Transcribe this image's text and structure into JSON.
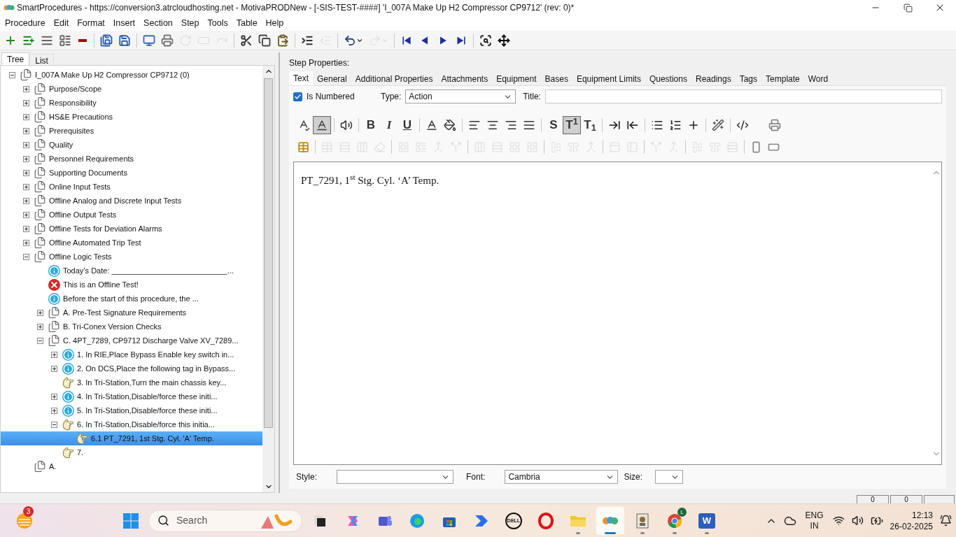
{
  "window": {
    "title": "SmartProcedures - https://conversion3.atrcloudhosting.net - MotivaPRODNew - [-SIS-TEST-####] 'I_007A Make Up H2 Compressor CP9712' (rev: 0)*"
  },
  "menu": [
    "Procedure",
    "Edit",
    "Format",
    "Insert",
    "Section",
    "Step",
    "Tools",
    "Table",
    "Help"
  ],
  "toolbar": [
    {
      "kind": "add",
      "disabled": false
    },
    {
      "kind": "add-child",
      "disabled": false
    },
    {
      "kind": "list",
      "disabled": false
    },
    {
      "kind": "properties",
      "disabled": false
    },
    {
      "kind": "remove",
      "disabled": false
    },
    {
      "kind": "separator"
    },
    {
      "kind": "save-all",
      "disabled": false
    },
    {
      "kind": "save",
      "disabled": false
    },
    {
      "kind": "separator"
    },
    {
      "kind": "computer",
      "disabled": false
    },
    {
      "kind": "print",
      "disabled": false
    },
    {
      "kind": "refresh",
      "disabled": true
    },
    {
      "kind": "form",
      "disabled": true
    },
    {
      "kind": "forward",
      "disabled": true
    },
    {
      "kind": "separator"
    },
    {
      "kind": "cut",
      "disabled": false
    },
    {
      "kind": "copy",
      "disabled": false
    },
    {
      "kind": "paste",
      "disabled": false
    },
    {
      "kind": "separator"
    },
    {
      "kind": "indent",
      "disabled": false
    },
    {
      "kind": "outdent",
      "disabled": true
    },
    {
      "kind": "separator"
    },
    {
      "kind": "undo",
      "disabled": false
    },
    {
      "kind": "redo",
      "disabled": true
    },
    {
      "kind": "separator"
    },
    {
      "kind": "first",
      "disabled": false
    },
    {
      "kind": "prev",
      "disabled": false
    },
    {
      "kind": "next",
      "disabled": false
    },
    {
      "kind": "last",
      "disabled": false
    },
    {
      "kind": "separator"
    },
    {
      "kind": "find",
      "disabled": false
    },
    {
      "kind": "move",
      "disabled": false
    }
  ],
  "left_tabs": [
    {
      "label": "Tree",
      "selected": true
    },
    {
      "label": "List",
      "selected": false
    }
  ],
  "tree": [
    {
      "label": "I_007A Make Up H2 Compressor CP9712 (0)",
      "kind": "section",
      "expandable": true,
      "expanded": true,
      "selected": false,
      "children": [
        {
          "label": "Purpose/Scope",
          "kind": "section",
          "expandable": true,
          "expanded": false,
          "selected": false
        },
        {
          "label": "Responsibility",
          "kind": "section",
          "expandable": true,
          "expanded": false,
          "selected": false
        },
        {
          "label": "HS&E Precautions",
          "kind": "section",
          "expandable": true,
          "expanded": false,
          "selected": false
        },
        {
          "label": "Prerequisites",
          "kind": "section",
          "expandable": true,
          "expanded": false,
          "selected": false
        },
        {
          "label": "Quality",
          "kind": "section",
          "expandable": true,
          "expanded": false,
          "selected": false
        },
        {
          "label": "Personnel Requirements",
          "kind": "section",
          "expandable": true,
          "expanded": false,
          "selected": false
        },
        {
          "label": "Supporting Documents",
          "kind": "section",
          "expandable": true,
          "expanded": false,
          "selected": false
        },
        {
          "label": "Online Input Tests",
          "kind": "section",
          "expandable": true,
          "expanded": false,
          "selected": false
        },
        {
          "label": "Offline Analog and Discrete Input Tests",
          "kind": "section",
          "expandable": true,
          "expanded": false,
          "selected": false
        },
        {
          "label": "Offline Output Tests",
          "kind": "section",
          "expandable": true,
          "expanded": false,
          "selected": false
        },
        {
          "label": "Offline Tests for Deviation Alarms",
          "kind": "section",
          "expandable": true,
          "expanded": false,
          "selected": false
        },
        {
          "label": "Offline Automated Trip Test",
          "kind": "section",
          "expandable": true,
          "expanded": false,
          "selected": false
        },
        {
          "label": "Offline Logic Tests",
          "kind": "section",
          "expandable": true,
          "expanded": true,
          "selected": false,
          "children": [
            {
              "label": "Today’s Date: ___________________________...",
              "kind": "info",
              "expandable": false,
              "expanded": false,
              "selected": false
            },
            {
              "label": "This is an Offline Test!",
              "kind": "error",
              "expandable": false,
              "expanded": false,
              "selected": false
            },
            {
              "label": "Before the start of this procedure, the ...",
              "kind": "info",
              "expandable": false,
              "expanded": false,
              "selected": false
            },
            {
              "label": "A. Pre-Test Signature Requirements",
              "kind": "section",
              "expandable": true,
              "expanded": false,
              "selected": false
            },
            {
              "label": "B. Tri-Conex Version Checks",
              "kind": "section",
              "expandable": true,
              "expanded": false,
              "selected": false
            },
            {
              "label": "C. 4PT_7289, CP9712 Discharge Valve XV_7289...",
              "kind": "section",
              "expandable": true,
              "expanded": true,
              "selected": false,
              "children": [
                {
                  "label": "1. In RIE,Place Bypass Enable key switch in...",
                  "kind": "info",
                  "expandable": true,
                  "expanded": false,
                  "selected": false
                },
                {
                  "label": "2. On DCS,Place the following tag in Bypass...",
                  "kind": "info",
                  "expandable": true,
                  "expanded": false,
                  "selected": false
                },
                {
                  "label": "3. In Tri-Station,Turn the main chassis key...",
                  "kind": "action",
                  "expandable": false,
                  "expanded": false,
                  "selected": false
                },
                {
                  "label": "4. In Tri-Station,Disable/force these initi...",
                  "kind": "info",
                  "expandable": true,
                  "expanded": false,
                  "selected": false
                },
                {
                  "label": "5. In Tri-Station,Disable/force these initi...",
                  "kind": "info",
                  "expandable": true,
                  "expanded": false,
                  "selected": false
                },
                {
                  "label": "6. In Tri-Station,Disable/force this initia...",
                  "kind": "action",
                  "expandable": true,
                  "expanded": true,
                  "selected": false,
                  "children": [
                    {
                      "label": "6.1 PT_7291, 1st Stg. Cyl. 'A' Temp.",
                      "kind": "action",
                      "expandable": false,
                      "expanded": false,
                      "selected": true
                    }
                  ]
                },
                {
                  "label": "7.",
                  "kind": "action",
                  "expandable": false,
                  "expanded": false,
                  "selected": false
                }
              ]
            }
          ]
        },
        {
          "label": "A.",
          "kind": "section",
          "expandable": false,
          "expanded": false,
          "selected": false
        }
      ]
    }
  ],
  "step_properties": {
    "heading": "Step Properties:",
    "tabs": [
      {
        "label": "Text",
        "selected": true
      },
      {
        "label": "General",
        "selected": false
      },
      {
        "label": "Additional Properties",
        "selected": false
      },
      {
        "label": "Attachments",
        "selected": false
      },
      {
        "label": "Equipment",
        "selected": false
      },
      {
        "label": "Bases",
        "selected": false
      },
      {
        "label": "Equipment Limits",
        "selected": false
      },
      {
        "label": "Questions",
        "selected": false
      },
      {
        "label": "Readings",
        "selected": false
      },
      {
        "label": "Tags",
        "selected": false
      },
      {
        "label": "Template",
        "selected": false
      },
      {
        "label": "Word",
        "selected": false
      }
    ],
    "is_numbered": {
      "label": "Is Numbered",
      "checked": true
    },
    "type": {
      "label": "Type:",
      "value": "Action"
    },
    "title": {
      "label": "Title:"
    },
    "format_row_1": [
      {
        "kind": "spell",
        "pressed": false
      },
      {
        "kind": "spell-auto",
        "pressed": true
      },
      {
        "kind": "separator"
      },
      {
        "kind": "speaker",
        "pressed": false
      },
      {
        "kind": "separator"
      },
      {
        "kind": "bold",
        "label": "B",
        "pressed": false
      },
      {
        "kind": "italic",
        "label": "I",
        "pressed": false
      },
      {
        "kind": "underline",
        "label": "U",
        "pressed": false
      },
      {
        "kind": "separator"
      },
      {
        "kind": "font-color",
        "pressed": false
      },
      {
        "kind": "fill",
        "pressed": false
      },
      {
        "kind": "separator"
      },
      {
        "kind": "align-left",
        "pressed": false
      },
      {
        "kind": "align-center",
        "pressed": false
      },
      {
        "kind": "align-right",
        "pressed": false
      },
      {
        "kind": "justify",
        "pressed": false
      },
      {
        "kind": "separator"
      },
      {
        "kind": "strike",
        "label": "S",
        "pressed": false
      },
      {
        "kind": "superscript",
        "label": "T$^{1}$",
        "pressed": true
      },
      {
        "kind": "subscript",
        "label": "T$_{1}$",
        "pressed": false
      },
      {
        "kind": "separator"
      },
      {
        "kind": "indent-right",
        "pressed": false
      },
      {
        "kind": "indent-left",
        "pressed": false
      },
      {
        "kind": "separator"
      },
      {
        "kind": "bullets",
        "pressed": false
      },
      {
        "kind": "numbers",
        "pressed": false
      },
      {
        "kind": "plus-line",
        "pressed": false
      },
      {
        "kind": "separator"
      },
      {
        "kind": "wand",
        "pressed": false
      },
      {
        "kind": "separator"
      },
      {
        "kind": "code",
        "pressed": false
      },
      {
        "kind": "gap"
      },
      {
        "kind": "print",
        "pressed": false
      }
    ],
    "format_row_2": [
      {
        "kind": "table-insert",
        "disabled": false
      },
      {
        "kind": "separator"
      },
      {
        "kind": "table-delete",
        "disabled": true
      },
      {
        "kind": "rows",
        "disabled": true
      },
      {
        "kind": "cols",
        "disabled": true
      },
      {
        "kind": "erase",
        "disabled": true
      },
      {
        "kind": "separator"
      },
      {
        "kind": "grid",
        "disabled": true
      },
      {
        "kind": "properties",
        "disabled": true
      },
      {
        "kind": "merge",
        "disabled": true
      },
      {
        "kind": "split",
        "disabled": true
      },
      {
        "kind": "separator"
      },
      {
        "kind": "cols",
        "disabled": true
      },
      {
        "kind": "rows",
        "disabled": true
      },
      {
        "kind": "grid",
        "disabled": true
      },
      {
        "kind": "grid",
        "disabled": true
      },
      {
        "kind": "separator"
      },
      {
        "kind": "align-h",
        "disabled": true
      },
      {
        "kind": "align-v",
        "disabled": true
      },
      {
        "kind": "merge",
        "disabled": true
      },
      {
        "kind": "separator"
      },
      {
        "kind": "panel-top",
        "disabled": true
      },
      {
        "kind": "panel-left",
        "disabled": true
      },
      {
        "kind": "separator"
      },
      {
        "kind": "split",
        "disabled": true
      },
      {
        "kind": "merge",
        "disabled": true
      },
      {
        "kind": "separator"
      },
      {
        "kind": "align-h",
        "disabled": true
      },
      {
        "kind": "align-v",
        "disabled": true
      },
      {
        "kind": "rows",
        "disabled": true
      },
      {
        "kind": "separator"
      },
      {
        "kind": "rect-v",
        "disabled": false
      },
      {
        "kind": "rect-h",
        "disabled": false
      }
    ],
    "editor_text": "PT_7291, 1$^{st}$ Stg. Cyl. ‘A’ Temp.",
    "style": {
      "label": "Style:"
    },
    "font": {
      "label": "Font:",
      "value": "Cambria"
    },
    "size": {
      "label": "Size:"
    }
  },
  "status_bar": [
    "0",
    "0"
  ],
  "taskbar": {
    "weather_badge": "3",
    "search": "Search",
    "apps": [
      {
        "kind": "task-view",
        "running": false,
        "active": false
      },
      {
        "kind": "copilot",
        "running": false,
        "active": false
      },
      {
        "kind": "teams",
        "running": false,
        "active": false
      },
      {
        "kind": "edge",
        "running": false,
        "active": false
      },
      {
        "kind": "store",
        "running": false,
        "active": false
      },
      {
        "kind": "automate",
        "running": false,
        "active": false
      },
      {
        "kind": "dell",
        "running": false,
        "active": false,
        "logo": "DELL"
      },
      {
        "kind": "opera",
        "running": false,
        "active": false
      },
      {
        "kind": "explorer",
        "running": true,
        "active": false
      },
      {
        "kind": "smartprocedures",
        "running": true,
        "active": true
      },
      {
        "kind": "certificate",
        "running": true,
        "active": false
      },
      {
        "kind": "chrome",
        "running": true,
        "active": false,
        "badge": "L"
      },
      {
        "kind": "word",
        "running": true,
        "active": false,
        "logo": "W"
      }
    ],
    "language": [
      "ENG",
      "IN"
    ],
    "time": "12:13",
    "date": "26-02-2025"
  }
}
